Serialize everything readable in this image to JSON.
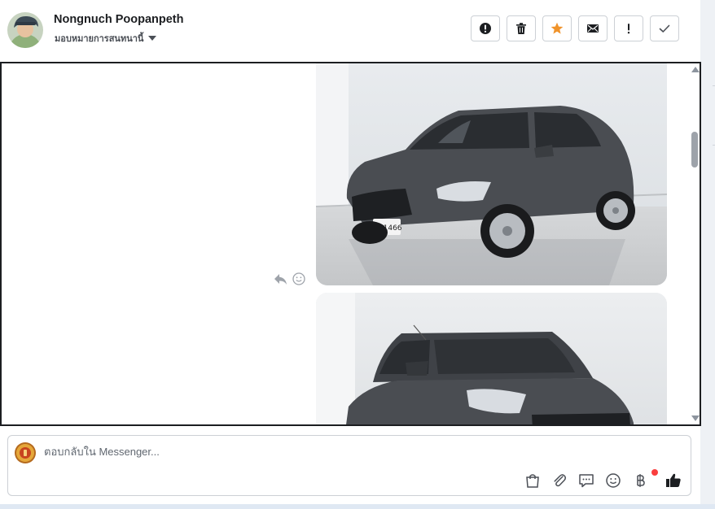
{
  "header": {
    "user_name": "Nongnuch Poopanpeth",
    "assign_label": "มอบหมายการสนทนานี้"
  },
  "toolbar": {
    "buttons": [
      {
        "name": "spam",
        "icon": "alert-circle-icon"
      },
      {
        "name": "delete",
        "icon": "trash-icon"
      },
      {
        "name": "star",
        "icon": "star-icon"
      },
      {
        "name": "mark-unread",
        "icon": "envelope-icon"
      },
      {
        "name": "follow-up",
        "icon": "exclamation-icon"
      },
      {
        "name": "mark-done",
        "icon": "check-icon"
      }
    ]
  },
  "conversation": {
    "images": [
      {
        "subject": "grey hatchback car, front three-quarter view",
        "plate": "กด 1466"
      },
      {
        "subject": "grey hatchback car, front view"
      }
    ]
  },
  "reply": {
    "placeholder": "ตอบกลับใน Messenger...",
    "tools": [
      "bag-icon",
      "paperclip-icon",
      "chat-bubble-icon",
      "smiley-icon",
      "baht-icon",
      "thumbs-up-icon"
    ]
  },
  "colors": {
    "star": "#f0932b",
    "badge_dot": "#fa3e3e",
    "car_body": "#4a4d52"
  }
}
